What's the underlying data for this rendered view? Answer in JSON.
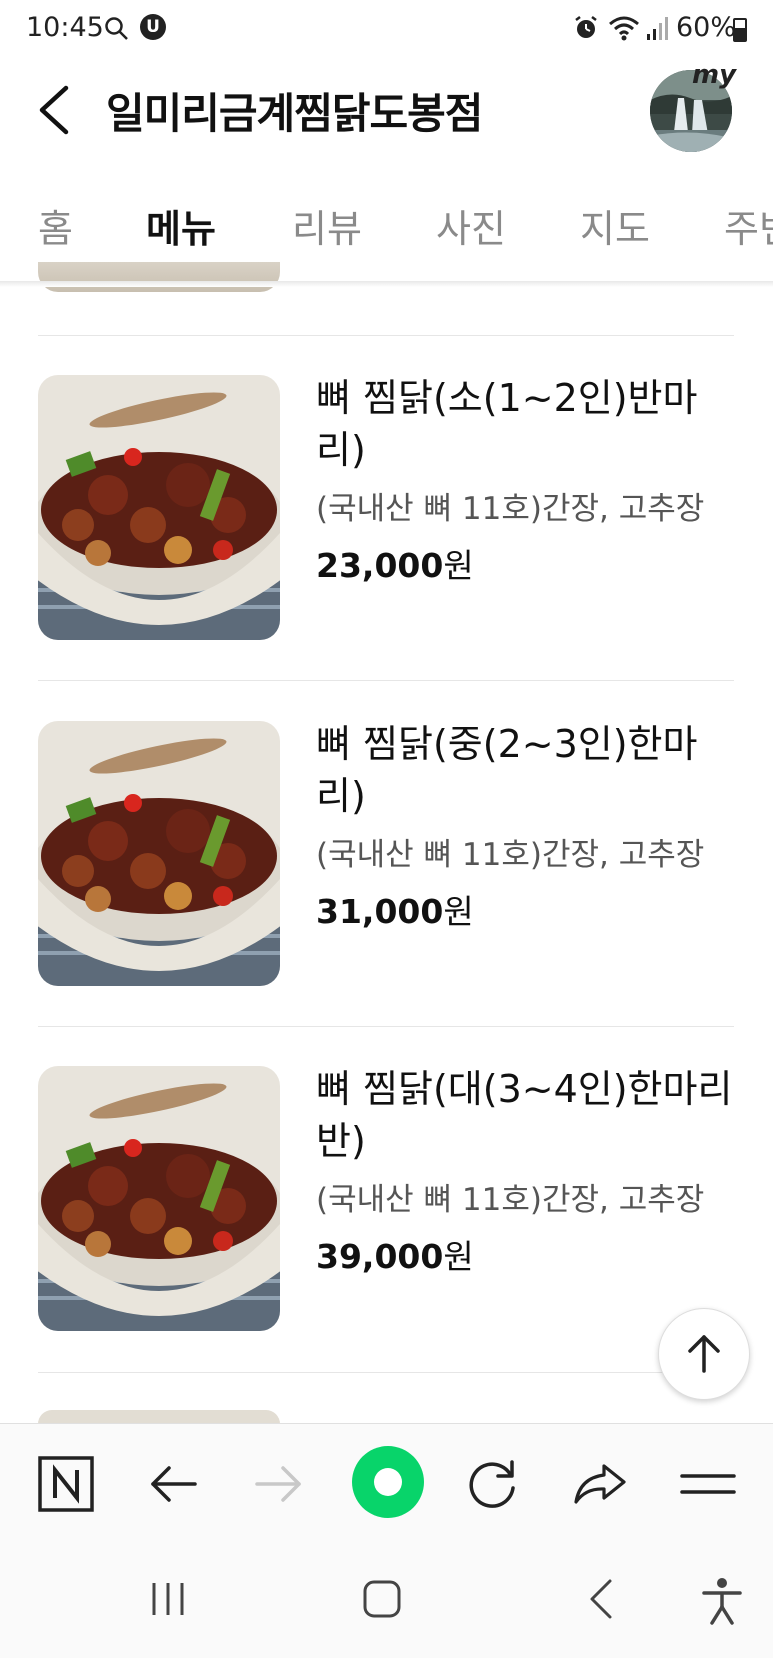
{
  "status_bar": {
    "time": "10:45",
    "battery_text": "60%",
    "battery_level": 0.6,
    "icons": [
      "search-icon",
      "u-app-icon",
      "alarm-icon",
      "wifi-icon",
      "signal-icon",
      "battery-icon"
    ]
  },
  "header": {
    "title": "일미리금계찜닭도봉점",
    "profile_badge": "my"
  },
  "tabs": [
    {
      "label": "홈",
      "active": false
    },
    {
      "label": "메뉴",
      "active": true
    },
    {
      "label": "리뷰",
      "active": false
    },
    {
      "label": "사진",
      "active": false
    },
    {
      "label": "지도",
      "active": false
    },
    {
      "label": "주변",
      "active": false
    }
  ],
  "menu_items": [
    {
      "name": "뼈 찜닭(소(1~2인)반마리)",
      "desc": "(국내산 뼈 11호)간장, 고추장",
      "price": "23,000",
      "currency": "원"
    },
    {
      "name": "뼈 찜닭(중(2~3인)한마리)",
      "desc": "(국내산 뼈 11호)간장, 고추장",
      "price": "31,000",
      "currency": "원"
    },
    {
      "name": "뼈 찜닭(대(3~4인)한마리반)",
      "desc": "(국내산 뼈 11호)간장, 고추장",
      "price": "39,000",
      "currency": "원"
    }
  ],
  "bottom_bar": {
    "icons": [
      "naver-n-icon",
      "back-arrow-icon",
      "forward-arrow-icon",
      "green-dot-icon",
      "refresh-icon",
      "share-icon",
      "menu-icon"
    ]
  },
  "nav_bar": {
    "icons": [
      "recent-apps-icon",
      "home-icon",
      "nav-back-icon",
      "accessibility-icon"
    ]
  },
  "colors": {
    "accent_green": "#08d46a",
    "text_primary": "#111111",
    "text_secondary": "#555555",
    "tab_inactive": "#8a8a8a"
  }
}
